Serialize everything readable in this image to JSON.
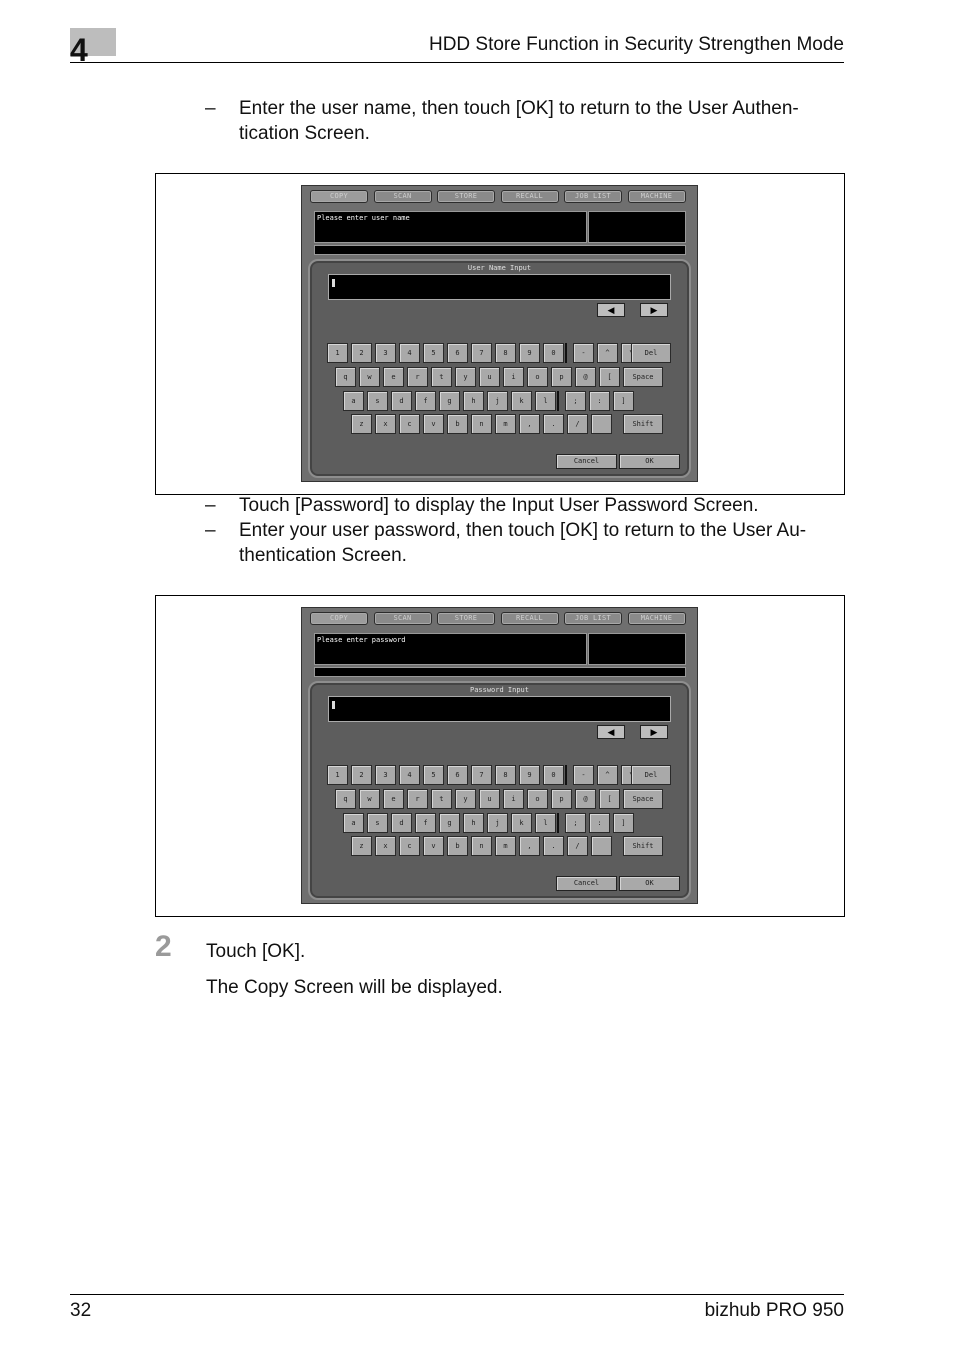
{
  "header": {
    "chapter": "4",
    "title": "HDD Store Function in Security Strengthen Mode"
  },
  "bullets_top": [
    {
      "dash": "–",
      "lines": [
        "Enter the user name, then touch [OK] to return to the User Authen-",
        "tication Screen."
      ]
    }
  ],
  "bullets_mid": [
    {
      "dash": "–",
      "lines": [
        "Touch [Password] to display the Input User Password Screen."
      ]
    },
    {
      "dash": "–",
      "lines": [
        "Enter your user password, then touch [OK] to return to the User Au-",
        "thentication Screen."
      ]
    }
  ],
  "screens": [
    {
      "message": "Please enter user name",
      "panel_title": "User Name Input"
    },
    {
      "message": "Please enter password",
      "panel_title": "Password Input"
    }
  ],
  "tabs": [
    "COPY",
    "SCAN",
    "STORE",
    "RECALL",
    "JOB LIST",
    "MACHINE"
  ],
  "arrows": {
    "left": "◀",
    "right": "▶"
  },
  "keyboard": {
    "row1": [
      "1",
      "2",
      "3",
      "4",
      "5",
      "6",
      "7",
      "8",
      "9",
      "0",
      "-",
      "^",
      "\\",
      "Del"
    ],
    "row2": [
      "q",
      "w",
      "e",
      "r",
      "t",
      "y",
      "u",
      "i",
      "o",
      "p",
      "@",
      "[",
      "Space"
    ],
    "row3": [
      "a",
      "s",
      "d",
      "f",
      "g",
      "h",
      "j",
      "k",
      "l",
      ";",
      ":",
      "]"
    ],
    "row4": [
      "z",
      "x",
      "c",
      "v",
      "b",
      "n",
      "m",
      ",",
      ".",
      "/",
      "",
      "Shift"
    ]
  },
  "buttons": {
    "cancel": "Cancel",
    "ok": "OK"
  },
  "step": {
    "number": "2",
    "text": "Touch [OK].",
    "result": "The Copy Screen will be displayed."
  },
  "footer": {
    "page": "32",
    "product": "bizhub PRO 950"
  }
}
